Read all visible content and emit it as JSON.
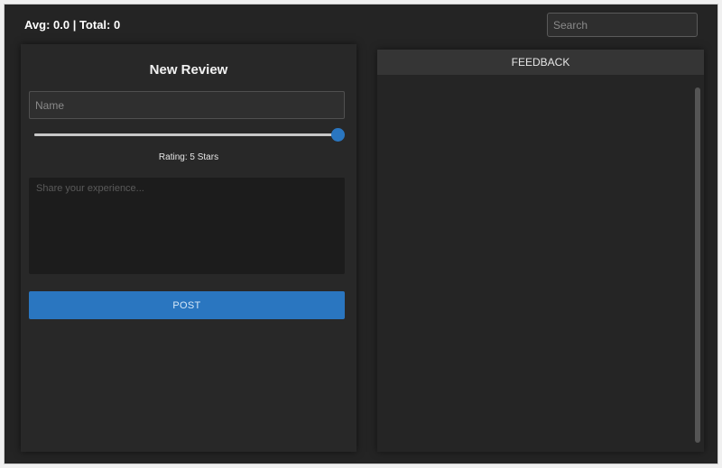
{
  "header": {
    "stats": "Avg: 0.0 | Total: 0",
    "search_placeholder": "Search"
  },
  "form": {
    "title": "New Review",
    "name_placeholder": "Name",
    "rating": {
      "value": 5,
      "max": 5,
      "label": "Rating: 5 Stars"
    },
    "review_placeholder": "Share your experience...",
    "post_label": "POST"
  },
  "feedback": {
    "title": "FEEDBACK",
    "items": []
  },
  "colors": {
    "accent": "#2a76c0",
    "background": "#242424",
    "panel": "#282828"
  }
}
